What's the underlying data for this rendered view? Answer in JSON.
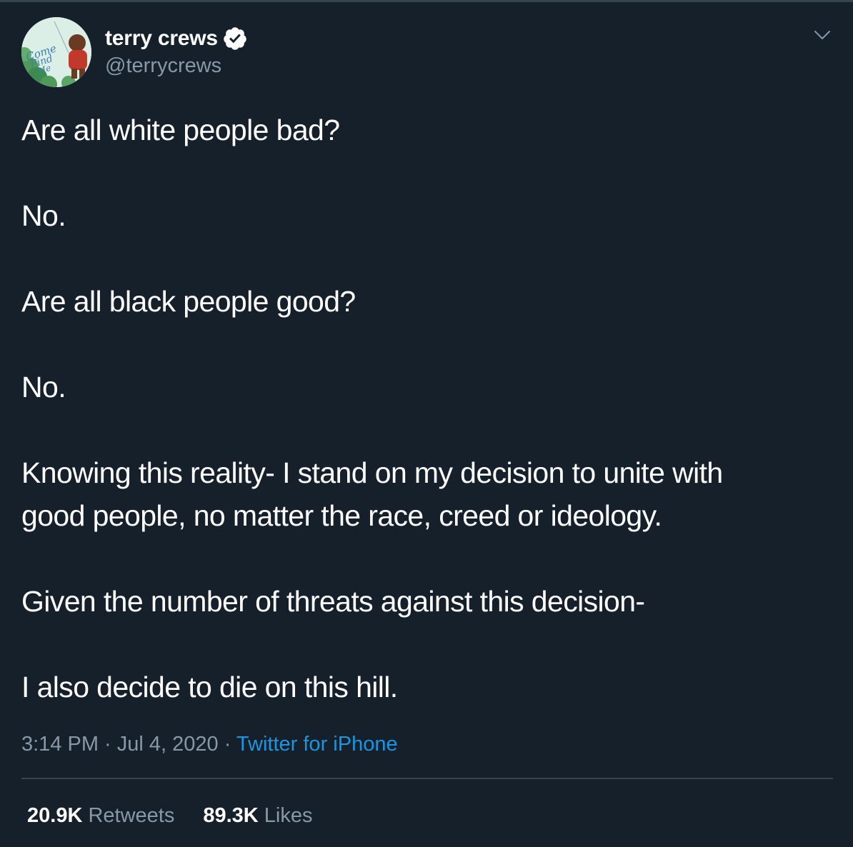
{
  "colors": {
    "background": "#15202b",
    "primary_text": "#ffffff",
    "secondary_text": "#8899a6",
    "link": "#1b95e0",
    "divider": "#38444d"
  },
  "author": {
    "display_name": "terry crews",
    "handle": "@terrycrews",
    "verified": true,
    "avatar_icon": "avatar-come-find-me-artwork",
    "avatar_text": "Come Find Me"
  },
  "menu_icon": "chevron-down-icon",
  "tweet": {
    "lines": [
      "Are all white people bad?",
      "No.",
      "Are all black people good?",
      "No.",
      "Knowing this reality- I stand on my decision to unite with",
      "good people, no matter the race, creed or ideology.",
      "Given the number of threats against this decision-",
      "I also decide to die on this hill."
    ]
  },
  "meta": {
    "time": "3:14 PM",
    "separator": " · ",
    "date": "Jul 4, 2020",
    "source": "Twitter for iPhone"
  },
  "stats": {
    "retweets_count": "20.9K",
    "retweets_label": "Retweets",
    "likes_count": "89.3K",
    "likes_label": "Likes"
  }
}
